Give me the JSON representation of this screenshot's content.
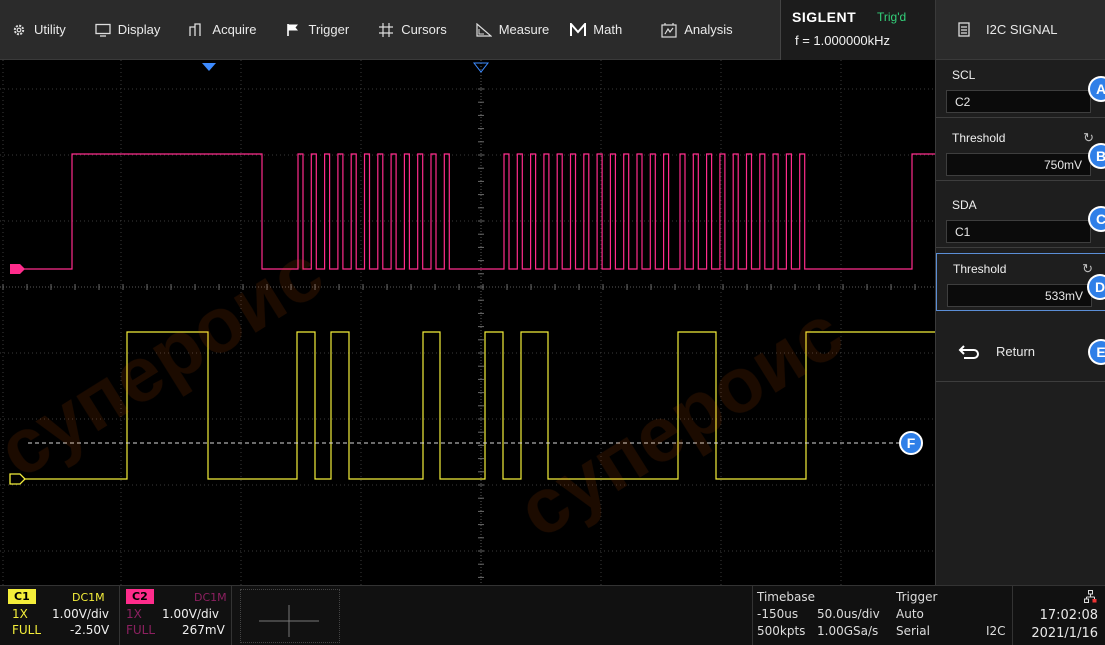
{
  "menu": {
    "items": [
      {
        "label": "Utility",
        "icon": "gear-icon"
      },
      {
        "label": "Display",
        "icon": "monitor-icon"
      },
      {
        "label": "Acquire",
        "icon": "acquire-icon"
      },
      {
        "label": "Trigger",
        "icon": "flag-icon"
      },
      {
        "label": "Cursors",
        "icon": "cursor-grid-icon"
      },
      {
        "label": "Measure",
        "icon": "measure-icon"
      },
      {
        "label": "Math",
        "icon": "math-icon"
      },
      {
        "label": "Analysis",
        "icon": "analysis-icon"
      }
    ],
    "brand": "SIGLENT",
    "trig_status": "Trig'd",
    "frequency": "f = 1.000000kHz"
  },
  "panel": {
    "title": "I2C SIGNAL",
    "scl_label": "SCL",
    "scl_value": "C2",
    "scl_threshold_label": "Threshold",
    "scl_threshold_value": "750mV",
    "sda_label": "SDA",
    "sda_value": "C1",
    "sda_threshold_label": "Threshold",
    "sda_threshold_value": "533mV",
    "return_label": "Return",
    "badges": [
      "A",
      "B",
      "C",
      "D",
      "E"
    ]
  },
  "marker": "F",
  "status": {
    "c1": {
      "tag": "C1",
      "coupling": "DC1M",
      "probe": "1X",
      "scale": "1.00V/div",
      "bw": "FULL",
      "offset": "-2.50V"
    },
    "c2": {
      "tag": "C2",
      "coupling": "DC1M",
      "probe": "1X",
      "scale": "1.00V/div",
      "bw": "FULL",
      "offset": "267mV"
    },
    "timebase": {
      "label": "Timebase",
      "delay": "-150us",
      "scale": "50.0us/div",
      "memory": "500kpts",
      "rate": "1.00GSa/s"
    },
    "trigger": {
      "label": "Trigger",
      "mode": "Auto",
      "type": "Serial",
      "source": "I2C"
    },
    "time": "17:02:08",
    "date": "2021/1/16"
  },
  "watermark": "супероис",
  "colors": {
    "c1": "#f4ee3a",
    "c2": "#ff2c8c",
    "accent": "#2f7fe8",
    "trig": "#33d17a"
  }
}
